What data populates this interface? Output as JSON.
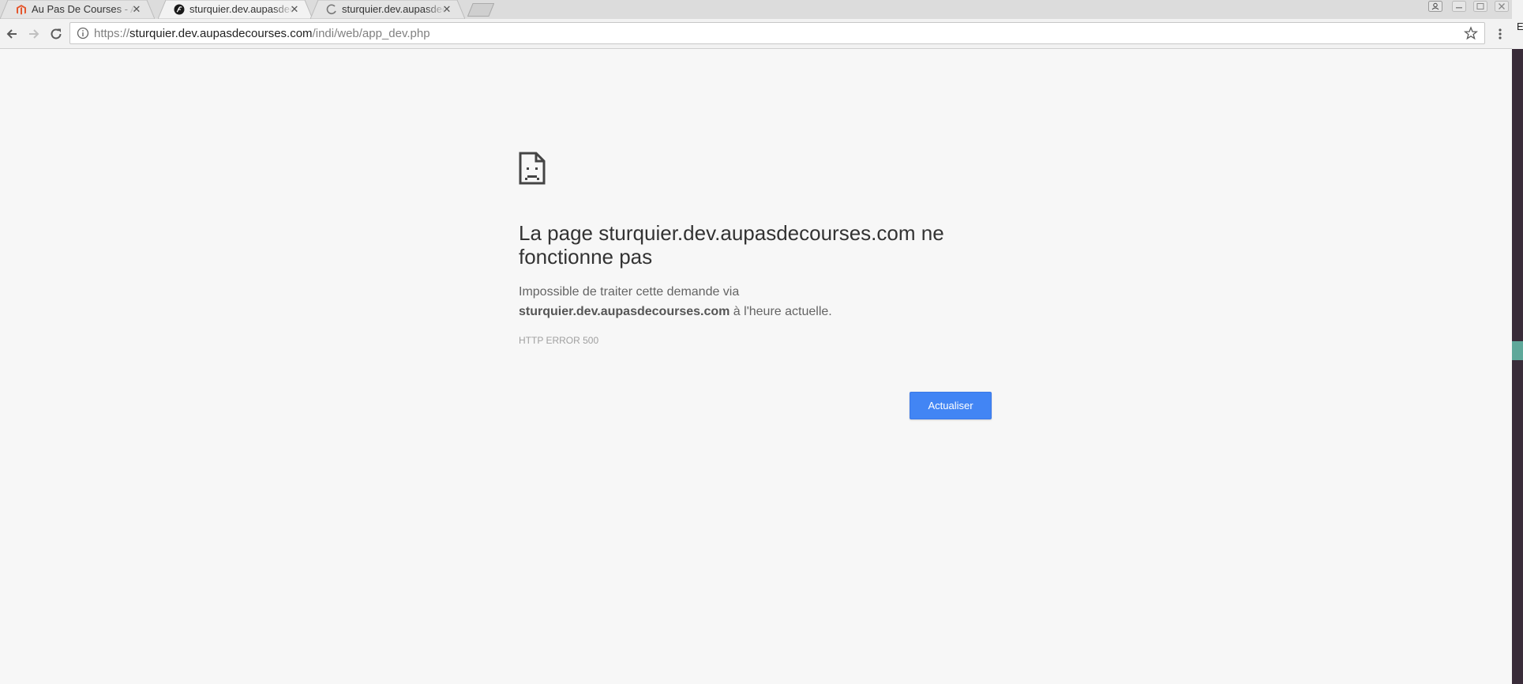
{
  "tabs": [
    {
      "title": "Au Pas De Courses - Ad",
      "icon": "magento-icon",
      "active": false
    },
    {
      "title": "sturquier.dev.aupasdec",
      "icon": "symfony-icon",
      "active": true
    },
    {
      "title": "sturquier.dev.aupasdec",
      "icon": "loading-icon",
      "active": false
    }
  ],
  "toolbar": {
    "url_prefix": "https://",
    "url_host": "sturquier.dev.aupasdecourses.com",
    "url_path": "/indi/web/app_dev.php"
  },
  "error": {
    "headline": "La page sturquier.dev.aupasdecourses.com ne fonctionne pas",
    "desc_before": "Impossible de traiter cette demande via",
    "desc_host": "sturquier.dev.aupasdecourses.com",
    "desc_after": " à l'heure actuelle.",
    "code": "HTTP ERROR 500",
    "reload_label": "Actualiser"
  },
  "side": {
    "glyph": "E"
  },
  "colors": {
    "page_bg": "#f7f7f7",
    "button_blue": "#4285f4",
    "tabstrip": "#dcdcdc",
    "toolbar": "#f2f2f2"
  }
}
